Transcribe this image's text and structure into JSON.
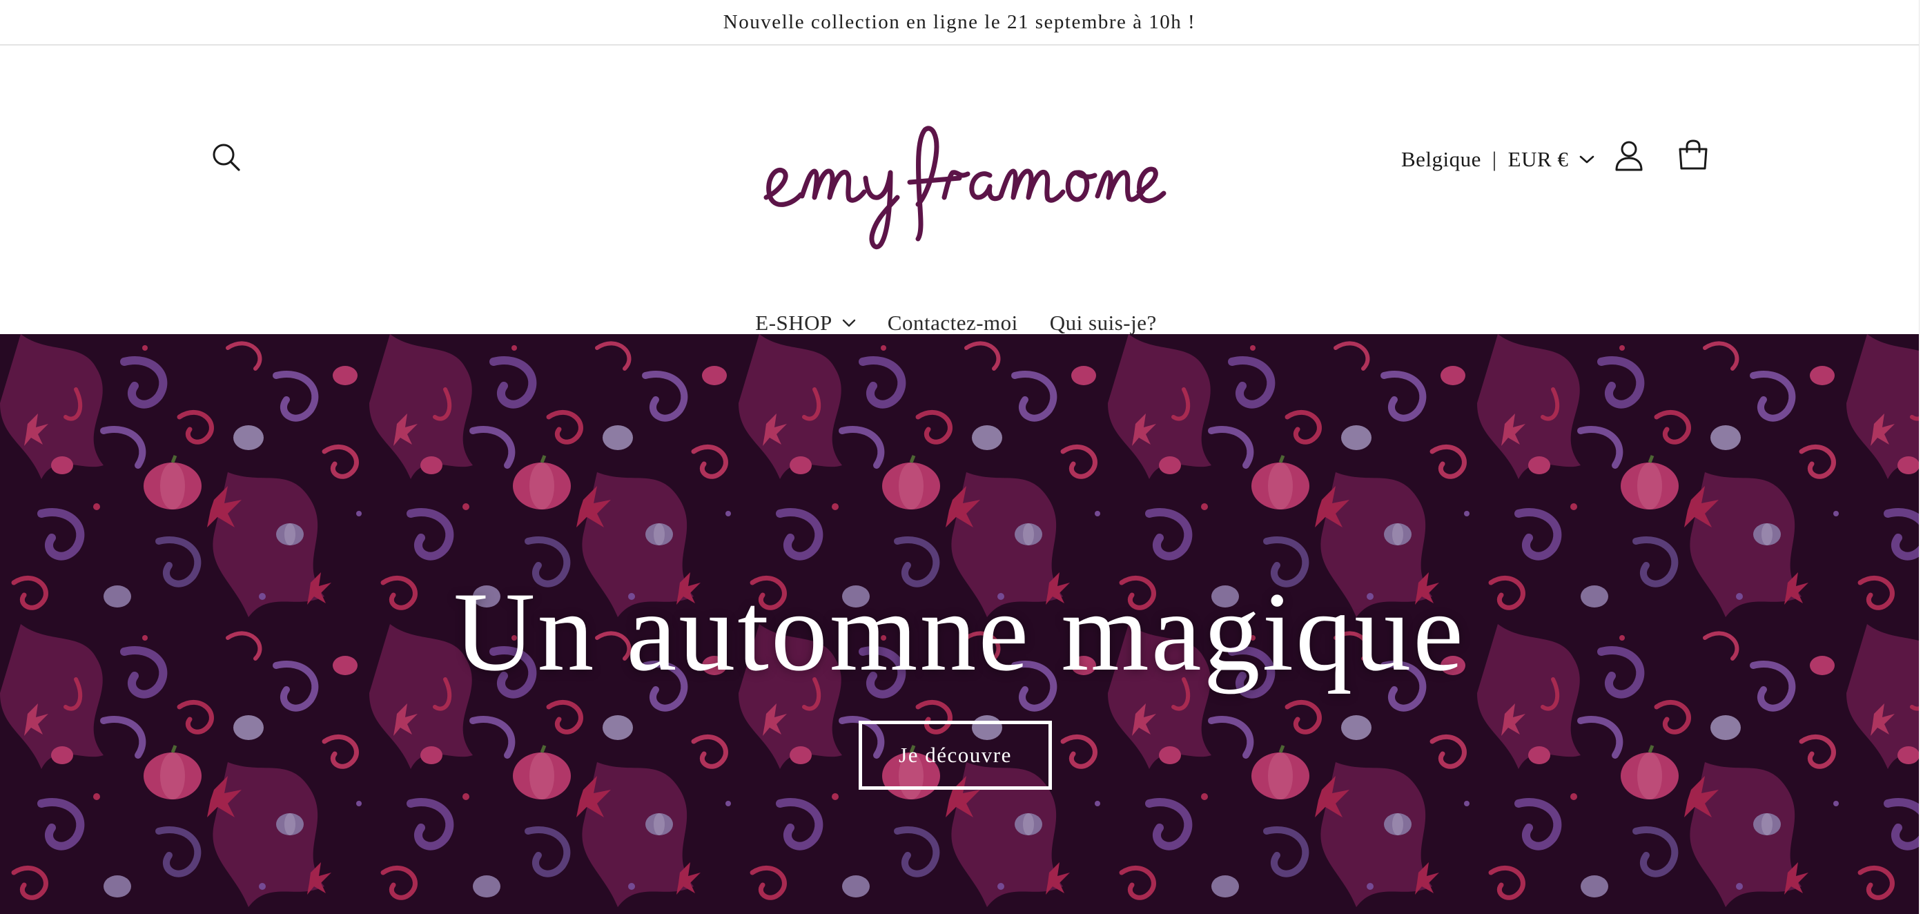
{
  "announcement": {
    "text": "Nouvelle collection en ligne le 21 septembre à 10h !"
  },
  "header": {
    "logo_text": "emy framone",
    "country": "Belgique",
    "currency": "EUR €"
  },
  "nav": {
    "items": [
      {
        "label": "E-SHOP",
        "has_dropdown": true
      },
      {
        "label": "Contactez-moi"
      },
      {
        "label": "Qui suis-je?"
      }
    ]
  },
  "hero": {
    "title": "Un automne magique",
    "button_label": "Je découvre"
  },
  "colors": {
    "logo": "#5c1448",
    "hero_background": "#2a0a26",
    "pattern_pink": "#c9335f",
    "pattern_purple": "#7b4a9e",
    "pattern_magenta": "#6b1b4f"
  },
  "icons": [
    "search-icon",
    "chevron-down-icon",
    "account-icon",
    "cart-icon"
  ]
}
